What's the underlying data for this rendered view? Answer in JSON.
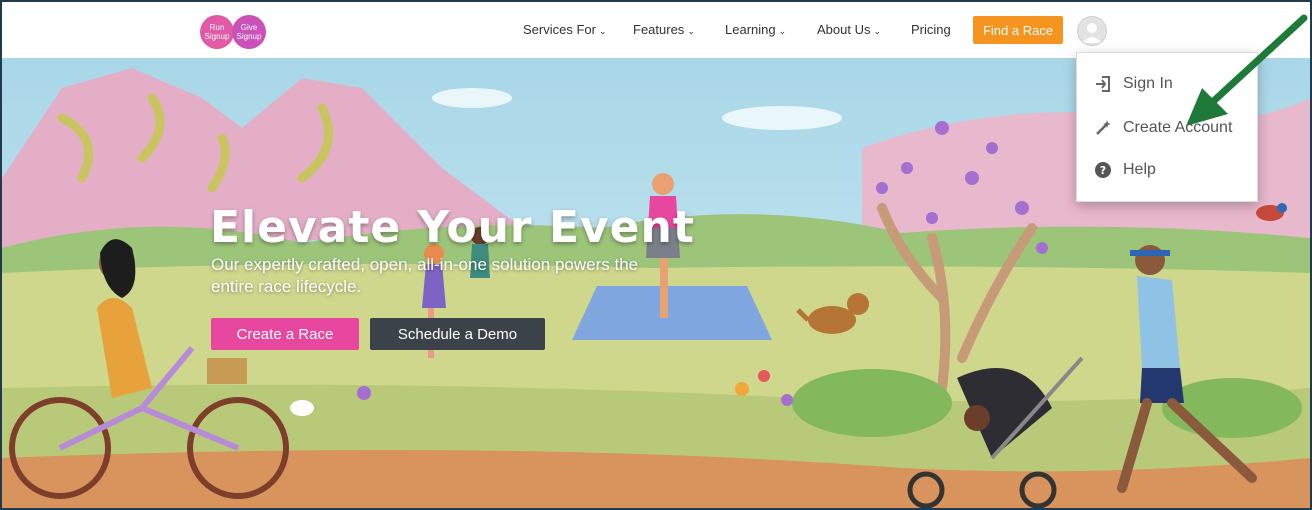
{
  "logo": {
    "left_text": "Run Signup",
    "right_text": "Give Signup"
  },
  "nav": {
    "items": [
      {
        "label": "Services For",
        "has_chevron": true
      },
      {
        "label": "Features",
        "has_chevron": true
      },
      {
        "label": "Learning",
        "has_chevron": true
      },
      {
        "label": "About Us",
        "has_chevron": true
      },
      {
        "label": "Pricing",
        "has_chevron": false
      }
    ],
    "find_race": "Find a Race",
    "chevron": "⌄"
  },
  "hero": {
    "title": "Elevate Your Event",
    "subtitle": "Our expertly crafted, open, all-in-one solution powers the entire race lifecycle.",
    "primary_button": "Create a Race",
    "secondary_button": "Schedule a Demo"
  },
  "account_menu": {
    "items": [
      {
        "label": "Sign In",
        "icon": "sign-in-icon"
      },
      {
        "label": "Create Account",
        "icon": "magic-wand-icon"
      },
      {
        "label": "Help",
        "icon": "question-circle-icon"
      }
    ]
  },
  "colors": {
    "accent_orange": "#f5941f",
    "primary_pink": "#e8479f",
    "secondary_dark": "#3c4249",
    "annotation_arrow": "#1f7a3a"
  }
}
